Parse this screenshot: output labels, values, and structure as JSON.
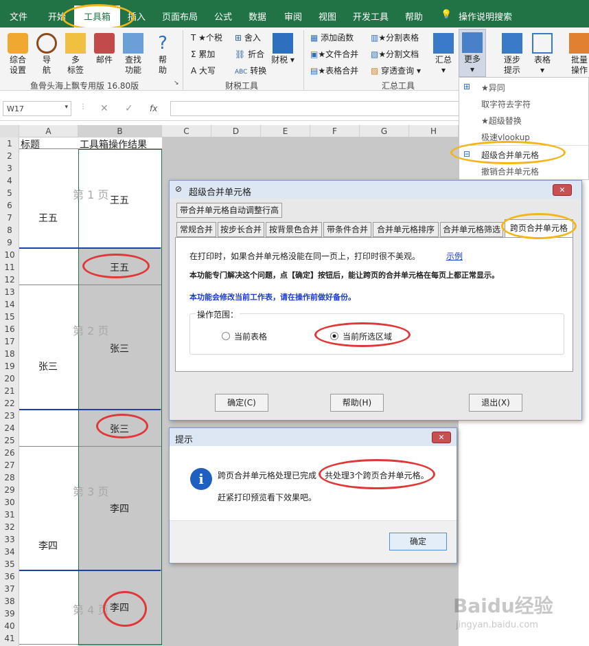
{
  "ribbon_tabs": [
    "文件",
    "开始",
    "工具箱",
    "插入",
    "页面布局",
    "公式",
    "数据",
    "审阅",
    "视图",
    "开发工具",
    "帮助"
  ],
  "tell_me": "操作说明搜索",
  "ribbon": {
    "big_buttons": [
      "综合\n设置",
      "导\n航",
      "多\n标签",
      "邮件",
      "查找\n功能",
      "帮\n助"
    ],
    "group1_label": "鱼骨头海上飘专用版 16.80版",
    "tax_items": [
      "T ★个税",
      "Σ 累加",
      "A 大写"
    ],
    "tax_items2": [
      "舍入",
      "折合",
      "转换"
    ],
    "tax_big": "财税",
    "tax_group_label": "财税工具",
    "sum_items": [
      "添加函数",
      "★文件合并",
      "★表格合并"
    ],
    "sum_items2": [
      "★分割表格",
      "★分割文档",
      "穿透查询"
    ],
    "sum_big": "汇总",
    "sum_group_label": "汇总工具",
    "more": "更多",
    "step": "逐步\n提示",
    "table": "表格",
    "batch": "批量\n操作"
  },
  "formula_bar": {
    "name_box": "W17",
    "fx": "fx"
  },
  "columns": [
    "A",
    "B",
    "C",
    "D",
    "E",
    "F",
    "G",
    "H"
  ],
  "rows": [
    "1",
    "2",
    "3",
    "4",
    "5",
    "6",
    "7",
    "8",
    "9",
    "10",
    "11",
    "12",
    "13",
    "14",
    "15",
    "16",
    "17",
    "18",
    "19",
    "20",
    "21",
    "22",
    "23",
    "24",
    "25",
    "26",
    "27",
    "28",
    "29",
    "30",
    "31",
    "32",
    "33",
    "34",
    "35",
    "36",
    "37",
    "38",
    "39",
    "40",
    "41"
  ],
  "sheet": {
    "a1": "标题",
    "b1": "工具箱操作结果",
    "names": [
      "王五",
      "张三",
      "李四"
    ],
    "b_values": [
      "王五",
      "王五",
      "张三",
      "张三",
      "李四",
      "李四"
    ],
    "pages": [
      "第 1 页",
      "第 2 页",
      "第 3 页",
      "第 4 页"
    ]
  },
  "menu_items": [
    "★异同",
    "取字符去字符",
    "★超级替换",
    "极速vlookup",
    "超级合并单元格",
    "撤销合并单元格"
  ],
  "dialog1": {
    "title": "超级合并单元格",
    "tab_top": "带合并单元格自动调整行高",
    "tabs": [
      "常规合并",
      "按步长合并",
      "按背景色合并",
      "带条件合并",
      "合并单元格排序",
      "合并单元格筛选",
      "跨页合并单元格"
    ],
    "line1": "在打印时，如果合并单元格没能在同一页上，打印时很不美观。",
    "example": "示例",
    "line2": "本功能专门解决这个问题，点【确定】按钮后，能让跨页的合并单元格在每页上都正常显示。",
    "line3": "本功能会修改当前工作表，请在操作前做好备份。",
    "range_label": "操作范围：",
    "opt1": "当前表格",
    "opt2": "当前所选区域",
    "ok": "确定(C)",
    "help": "帮助(H)",
    "exit": "退出(X)"
  },
  "dialog2": {
    "title": "提示",
    "msg1": "跨页合并单元格处理已完成",
    "msg2": "共处理3个跨页合并单元格。",
    "msg3": "赶紧打印预览看下效果吧。",
    "ok": "确定"
  },
  "watermark": {
    "logo": "Baidu经验",
    "url": "jingyan.baidu.com"
  },
  "colors": {
    "excel_green": "#217346",
    "highlight_orange": "#f2b619",
    "mark_red": "#e03838",
    "page_border_blue": "#1f3fa8"
  }
}
